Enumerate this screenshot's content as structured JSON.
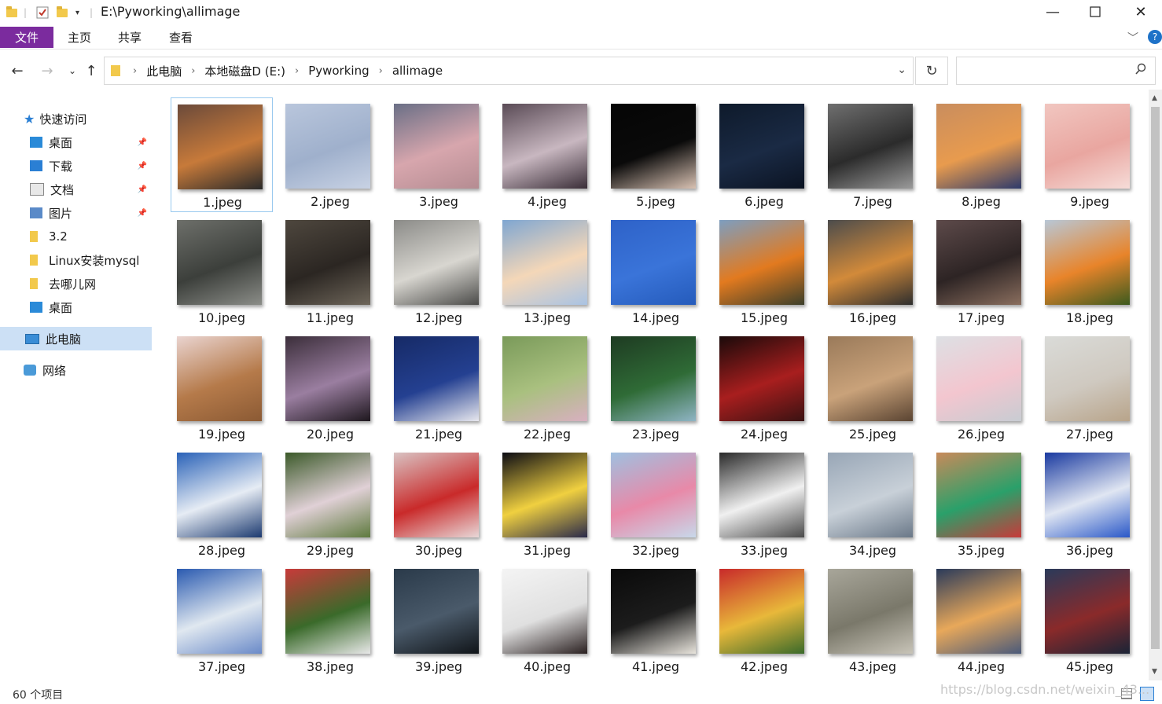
{
  "window": {
    "title": "E:\\Pyworking\\allimage"
  },
  "ribbon": {
    "file": "文件",
    "home": "主页",
    "share": "共享",
    "view": "查看"
  },
  "address": {
    "crumbs": [
      "此电脑",
      "本地磁盘D (E:)",
      "Pyworking",
      "allimage"
    ],
    "search_placeholder": ""
  },
  "sidebar": {
    "quick_access": "快速访问",
    "items": [
      {
        "label": "桌面",
        "icon": "desktop-icon",
        "pinned": true
      },
      {
        "label": "下载",
        "icon": "download-icon",
        "pinned": true
      },
      {
        "label": "文档",
        "icon": "document-icon",
        "pinned": true
      },
      {
        "label": "图片",
        "icon": "picture-icon",
        "pinned": true
      },
      {
        "label": "3.2",
        "icon": "folder-icon",
        "pinned": false
      },
      {
        "label": "Linux安装mysql",
        "icon": "folder-icon",
        "pinned": false
      },
      {
        "label": "去哪儿网",
        "icon": "folder-icon",
        "pinned": false
      },
      {
        "label": "桌面",
        "icon": "desktop-icon",
        "pinned": false
      }
    ],
    "this_pc": "此电脑",
    "network": "网络"
  },
  "files": [
    {
      "name": "1.jpeg",
      "colors": [
        "#6b4a3a",
        "#c77a3a",
        "#2a2a2a"
      ]
    },
    {
      "name": "2.jpeg",
      "colors": [
        "#b9c6dc",
        "#9fb0cc",
        "#c8d2e4"
      ]
    },
    {
      "name": "3.jpeg",
      "colors": [
        "#6a6f86",
        "#d7a6ad",
        "#b58c92"
      ]
    },
    {
      "name": "4.jpeg",
      "colors": [
        "#5a4b56",
        "#c8b7c0",
        "#3a2e38"
      ]
    },
    {
      "name": "5.jpeg",
      "colors": [
        "#050505",
        "#0a0a0a",
        "#d9c2b3"
      ]
    },
    {
      "name": "6.jpeg",
      "colors": [
        "#0e1a2b",
        "#1a2a44",
        "#0b1322"
      ]
    },
    {
      "name": "7.jpeg",
      "colors": [
        "#6f6f6f",
        "#2b2b2b",
        "#9a9a9a"
      ]
    },
    {
      "name": "8.jpeg",
      "colors": [
        "#c98d5e",
        "#e89b4e",
        "#2d3a6b"
      ]
    },
    {
      "name": "9.jpeg",
      "colors": [
        "#f1c6c0",
        "#e9a6a0",
        "#f6dcd8"
      ]
    },
    {
      "name": "10.jpeg",
      "colors": [
        "#6d6f6a",
        "#3c3f3b",
        "#8b8d88"
      ]
    },
    {
      "name": "11.jpeg",
      "colors": [
        "#4e473e",
        "#2b2622",
        "#6e665a"
      ]
    },
    {
      "name": "12.jpeg",
      "colors": [
        "#8b8b88",
        "#d8d6d0",
        "#4b4b49"
      ]
    },
    {
      "name": "13.jpeg",
      "colors": [
        "#7fa6d1",
        "#f4d7b8",
        "#a9c3e3"
      ]
    },
    {
      "name": "14.jpeg",
      "colors": [
        "#2e62c8",
        "#3a74d9",
        "#255bbb"
      ]
    },
    {
      "name": "15.jpeg",
      "colors": [
        "#7d9ec0",
        "#e27a1f",
        "#3c3f2a"
      ]
    },
    {
      "name": "16.jpeg",
      "colors": [
        "#4c4c4c",
        "#d28a3a",
        "#2e2e2e"
      ]
    },
    {
      "name": "17.jpeg",
      "colors": [
        "#5d4a4a",
        "#2d2424",
        "#8a6e5e"
      ]
    },
    {
      "name": "18.jpeg",
      "colors": [
        "#b8c7d6",
        "#e8842a",
        "#3c5a1e"
      ]
    },
    {
      "name": "19.jpeg",
      "colors": [
        "#ead4d0",
        "#b57a4a",
        "#8b5a34"
      ]
    },
    {
      "name": "20.jpeg",
      "colors": [
        "#3b2e3a",
        "#9a7ea0",
        "#1e171e"
      ]
    },
    {
      "name": "21.jpeg",
      "colors": [
        "#162a66",
        "#244091",
        "#e8e8ee"
      ]
    },
    {
      "name": "22.jpeg",
      "colors": [
        "#7a9a5a",
        "#a9c07f",
        "#d8b0c0"
      ]
    },
    {
      "name": "23.jpeg",
      "colors": [
        "#1e3b22",
        "#2f6b36",
        "#8fb4c4"
      ]
    },
    {
      "name": "24.jpeg",
      "colors": [
        "#1a0a0a",
        "#a81e1e",
        "#3a1212"
      ]
    },
    {
      "name": "25.jpeg",
      "colors": [
        "#9a7a5a",
        "#c9a27a",
        "#5a4432"
      ]
    },
    {
      "name": "26.jpeg",
      "colors": [
        "#dde0e4",
        "#f3c6cf",
        "#c8ccd2"
      ]
    },
    {
      "name": "27.jpeg",
      "colors": [
        "#dadbd8",
        "#cfc9c0",
        "#b8a48a"
      ]
    },
    {
      "name": "28.jpeg",
      "colors": [
        "#2a62b8",
        "#e6ecf4",
        "#1c3a70"
      ]
    },
    {
      "name": "29.jpeg",
      "colors": [
        "#3c5a2a",
        "#e0d0d6",
        "#5e7a3e"
      ]
    },
    {
      "name": "30.jpeg",
      "colors": [
        "#d9c2c2",
        "#c92a2a",
        "#e8d8d8"
      ]
    },
    {
      "name": "31.jpeg",
      "colors": [
        "#0c0c14",
        "#f0d040",
        "#2a2a4a"
      ]
    },
    {
      "name": "32.jpeg",
      "colors": [
        "#9fc0e0",
        "#e889a8",
        "#c8d8ea"
      ]
    },
    {
      "name": "33.jpeg",
      "colors": [
        "#2a2a2a",
        "#f0f0f0",
        "#4a4a4a"
      ]
    },
    {
      "name": "34.jpeg",
      "colors": [
        "#98a6b6",
        "#c8d0d8",
        "#6a7888"
      ]
    },
    {
      "name": "35.jpeg",
      "colors": [
        "#c88a5a",
        "#2aa06a",
        "#c83a3a"
      ]
    },
    {
      "name": "36.jpeg",
      "colors": [
        "#1a3aa0",
        "#e0e6f2",
        "#2a58c8"
      ]
    },
    {
      "name": "37.jpeg",
      "colors": [
        "#2a5ab0",
        "#e0e8f0",
        "#6a8ac8"
      ]
    },
    {
      "name": "38.jpeg",
      "colors": [
        "#c83a3a",
        "#3a6a2a",
        "#e8e8e8"
      ]
    },
    {
      "name": "39.jpeg",
      "colors": [
        "#2a3a4a",
        "#4a5a6a",
        "#101418"
      ]
    },
    {
      "name": "40.jpeg",
      "colors": [
        "#f4f4f4",
        "#e0e0e0",
        "#2a2020"
      ]
    },
    {
      "name": "41.jpeg",
      "colors": [
        "#0a0a0a",
        "#1c1c1c",
        "#e8e4dc"
      ]
    },
    {
      "name": "42.jpeg",
      "colors": [
        "#c82a2a",
        "#e8b83a",
        "#3a6a2a"
      ]
    },
    {
      "name": "43.jpeg",
      "colors": [
        "#a8a69a",
        "#7a786a",
        "#c8c4b8"
      ]
    },
    {
      "name": "44.jpeg",
      "colors": [
        "#2a3a5a",
        "#e8a85a",
        "#4a5a7a"
      ]
    },
    {
      "name": "45.jpeg",
      "colors": [
        "#2a3a5a",
        "#8a2a2a",
        "#1a2436"
      ]
    }
  ],
  "status": {
    "count": "60 个项目"
  },
  "watermark": "https://blog.csdn.net/weixin_43..."
}
